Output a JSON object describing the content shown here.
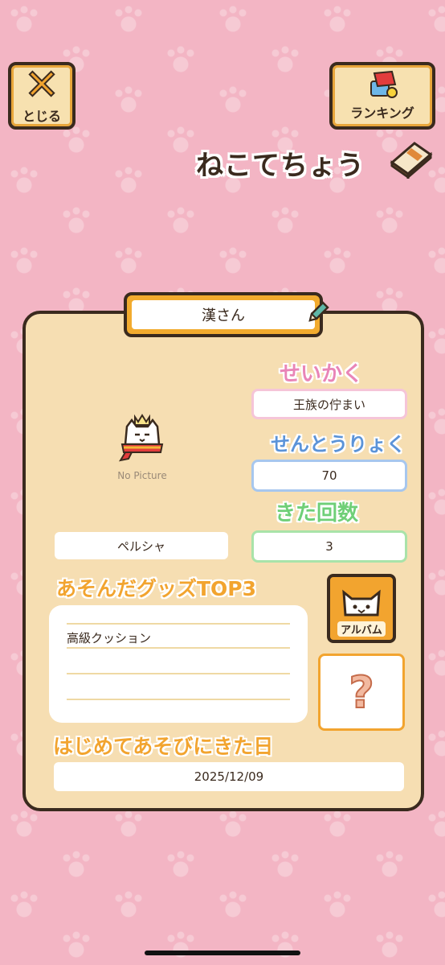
{
  "header": {
    "close_label": "とじる",
    "ranking_label": "ランキング",
    "title": "ねこてちょう"
  },
  "profile": {
    "name": "漢さん",
    "photo_placeholder": "No Picture",
    "breed": "ペルシャ",
    "personality_heading": "せいかく",
    "personality": "王族の佇まい",
    "power_heading": "せんとうりょく",
    "power": "70",
    "visits_heading": "きた回数",
    "visits": "3",
    "goods_heading": "あそんだグッズTOP3",
    "goods": [
      "高級クッション",
      "",
      ""
    ],
    "album_label": "アルバム",
    "first_visit_heading": "はじめてあそびにきた日",
    "first_visit": "2025/12/09"
  },
  "colors": {
    "background": "#f3b5c4",
    "card": "#f6deb2",
    "accent_orange": "#f2a42f",
    "personality_pink": "#e985b7",
    "power_blue": "#5b93d8",
    "visits_green": "#6fcf77"
  }
}
